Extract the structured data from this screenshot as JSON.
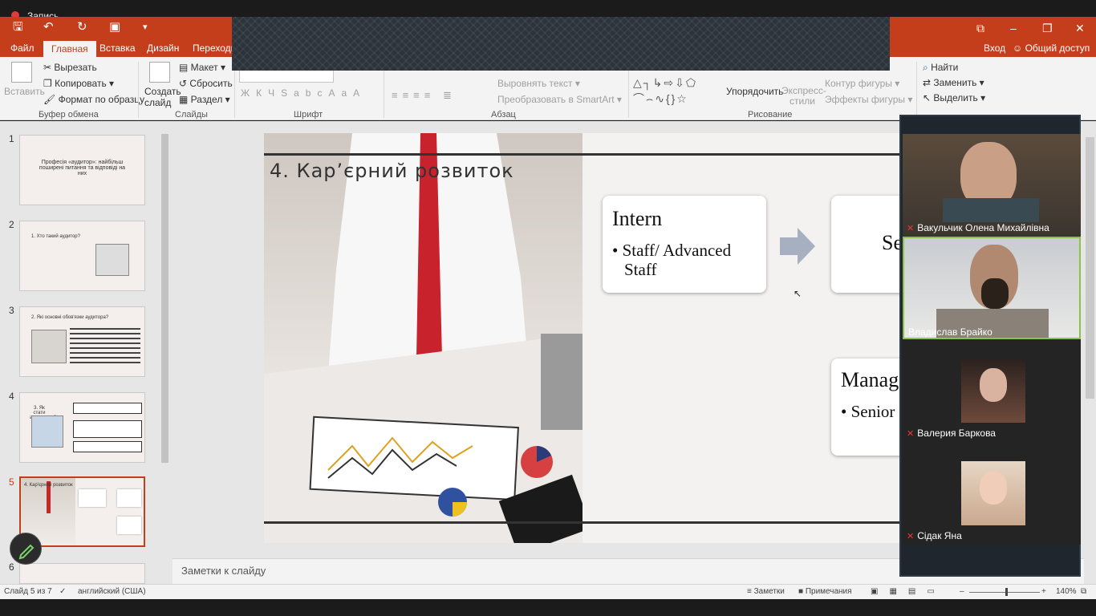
{
  "recording": {
    "label": "Запись"
  },
  "titlebar": {
    "icons": [
      "save-icon",
      "undo-icon",
      "redo-icon",
      "present-icon",
      "customize-icon"
    ],
    "window": [
      "restore-icon",
      "minimize-icon",
      "maximize-icon",
      "close-icon"
    ]
  },
  "tabs": [
    "Файл",
    "Главная",
    "Вставка",
    "Дизайн",
    "Переходь"
  ],
  "account": {
    "signin": "Вход",
    "share": "Общий доступ"
  },
  "ribbon": {
    "clipboard": {
      "paste": "Вставить",
      "cut": "Вырезать",
      "copy": "Копировать",
      "format": "Формат по образцу",
      "group": "Буфер обмена"
    },
    "slides": {
      "new_slide": "Создать слайд",
      "layout": "Макет",
      "reset": "Сбросить",
      "section": "Раздел",
      "group": "Слайды"
    },
    "font": {
      "group": "Шрифт",
      "bold": "Ж",
      "italic": "К",
      "underline": "Ч",
      "strike": "S",
      "spacing": "abc",
      "case": "Aa",
      "color": "A"
    },
    "paragraph": {
      "align_text": "Выровнять текст",
      "smartart": "Преобразовать в SmartArt",
      "group": "Абзац"
    },
    "drawing": {
      "arrange": "Упорядочить",
      "quick_styles": "Экспресс-стили",
      "shape_outline": "Контур фигуры",
      "shape_effects": "Эффекты фигуры",
      "group": "Рисование"
    },
    "editing": {
      "find": "Найти",
      "replace": "Заменить",
      "select": "Выделить"
    }
  },
  "thumbnails": [
    {
      "num": "1",
      "text": "Професія «аудитор»: найбільш поширені питання та відповіді на них"
    },
    {
      "num": "2",
      "text": "1. Хто такий аудитор?"
    },
    {
      "num": "3",
      "text": "2. Які основні обов'язки аудитора?"
    },
    {
      "num": "4",
      "text": "3. Як стати аудитором?"
    },
    {
      "num": "5",
      "text": "4. Кар'єрний розвиток"
    },
    {
      "num": "6",
      "text": ""
    }
  ],
  "slide": {
    "title": "4. Кар’єрний розвиток",
    "box1": {
      "heading": "Intern",
      "bullet1": "• Staff/ Advanced",
      "bullet2": "Staff"
    },
    "box2": {
      "heading": "Se"
    },
    "box3": {
      "heading": "Manag",
      "bullet": "• Senior"
    }
  },
  "notes": {
    "placeholder": "Заметки к слайду"
  },
  "status": {
    "slide": "Слайд 5 из 7",
    "lang": "английский (США)",
    "notes": "Заметки",
    "comments": "Примечания",
    "zoom": "140%"
  },
  "participants": [
    {
      "name": "Вакульчик Олена Михайлівна",
      "muted": true
    },
    {
      "name": "Владислав Брайко",
      "muted": false
    },
    {
      "name": "Валерия Баркова",
      "muted": true
    },
    {
      "name": "Сідак Яна",
      "muted": true
    }
  ]
}
